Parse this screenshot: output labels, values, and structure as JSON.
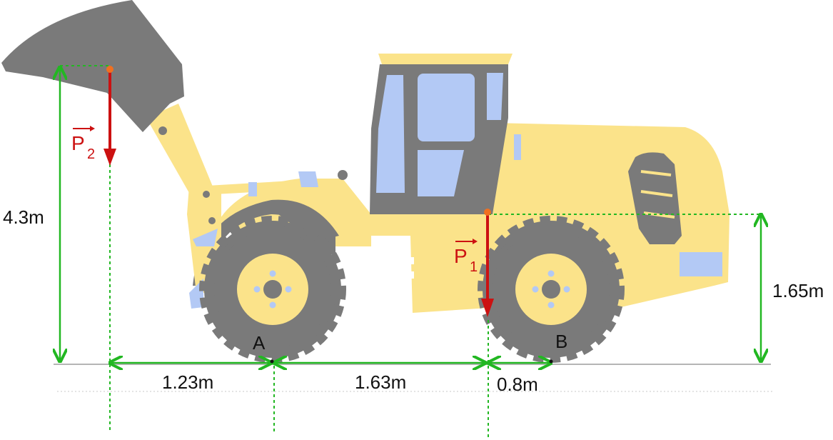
{
  "colors": {
    "body": "#fbe38a",
    "dark": "#7a7a7a",
    "glass": "#b3c9f5",
    "force": "#cc1111",
    "dimension": "#22b722",
    "ground": "#b5b5b5"
  },
  "forces": {
    "p1": {
      "letter": "P",
      "sub": "1"
    },
    "p2": {
      "letter": "P",
      "sub": "2"
    }
  },
  "points": {
    "a": "A",
    "b": "B"
  },
  "dimensions": {
    "height_p2": "4.3m",
    "height_p1": "1.65m",
    "p2_to_a": "1.23m",
    "a_to_p1": "1.63m",
    "p1_to_b": "0.8m"
  }
}
